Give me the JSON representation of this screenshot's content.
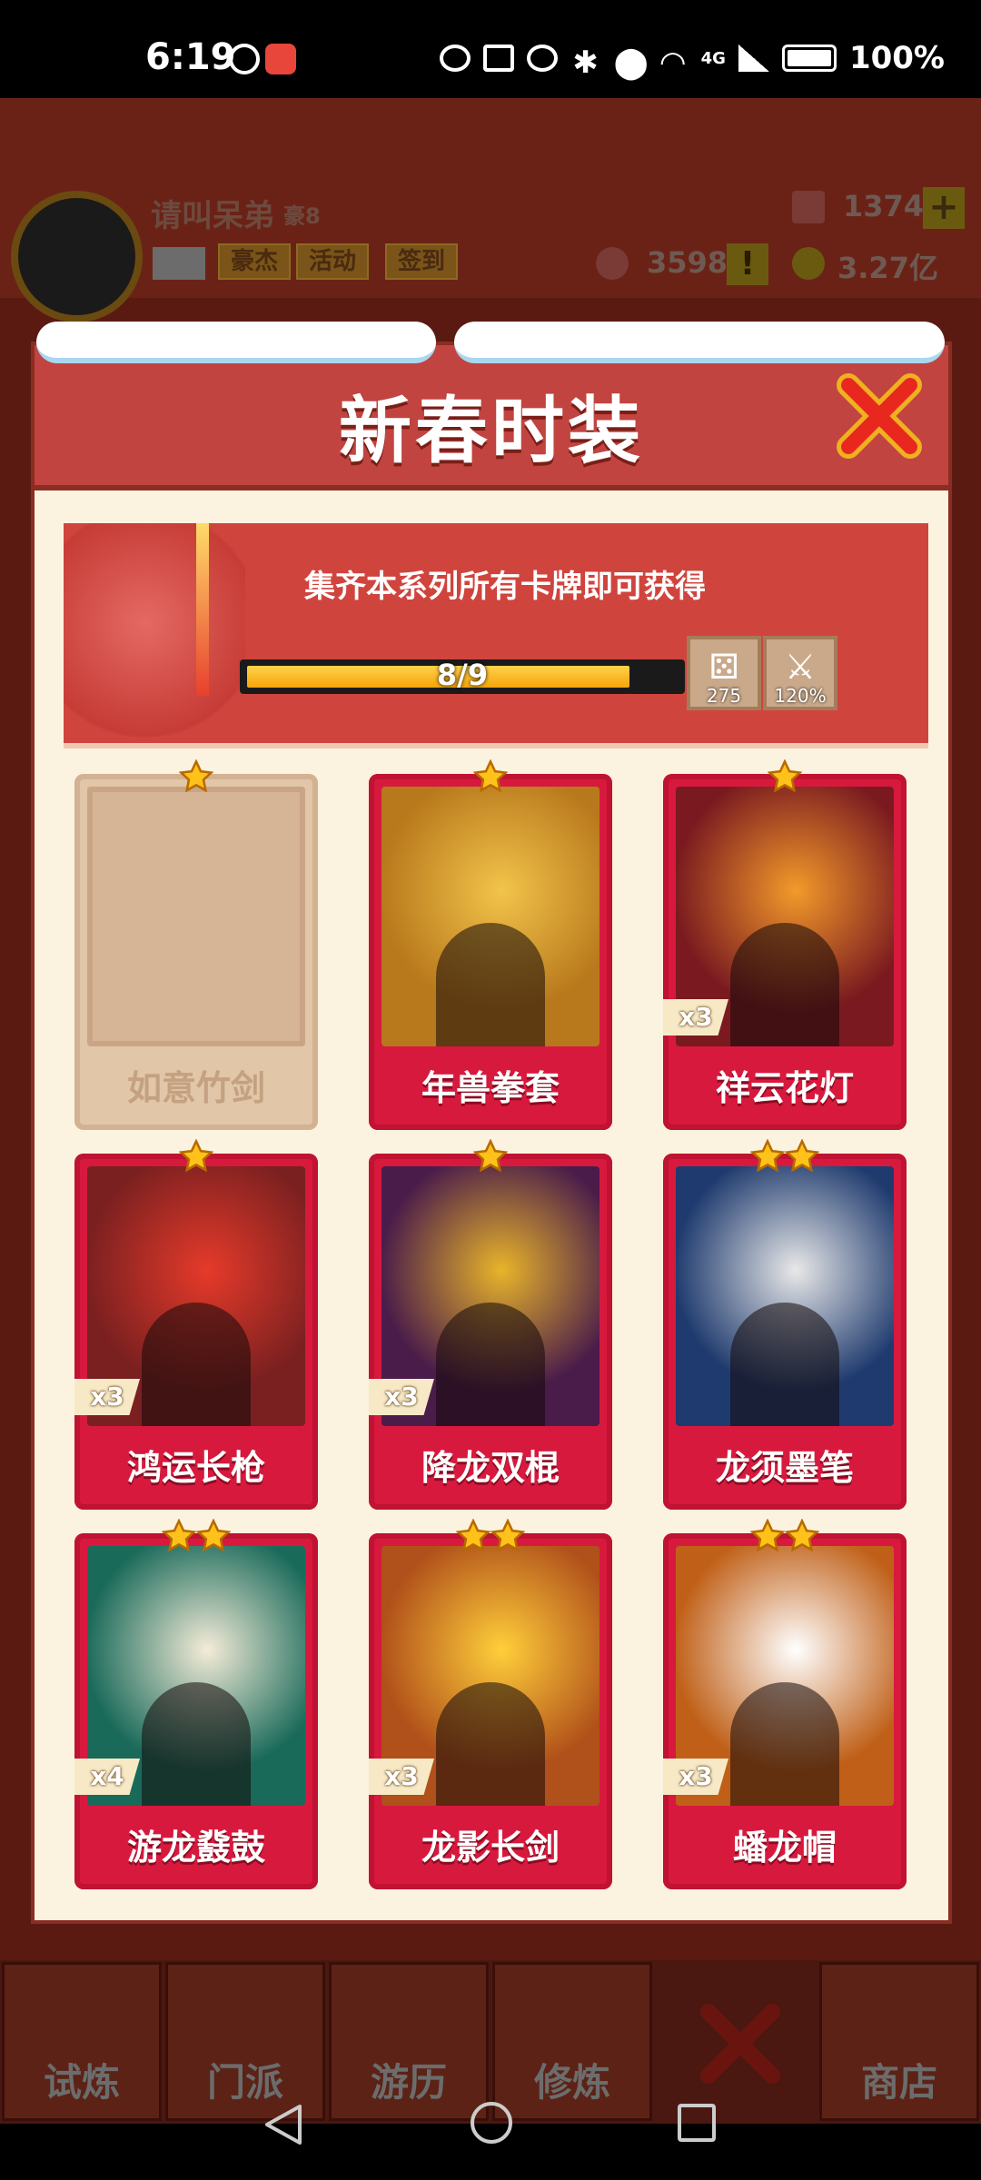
{
  "status_bar": {
    "time": "6:19",
    "battery": "100%",
    "network": "4G"
  },
  "player": {
    "name": "请叫呆弟",
    "rank": "豪8",
    "buttons": [
      "豪杰",
      "活动",
      "签到"
    ],
    "gems": "1374",
    "token": "3598",
    "gold": "3.27亿"
  },
  "modal": {
    "title": "新春时装",
    "banner_text": "集齐本系列所有卡牌即可获得",
    "progress": {
      "label": "8/9",
      "fraction": 0.889
    },
    "rewards": [
      {
        "icon": "dice-icon",
        "value": "275"
      },
      {
        "icon": "blade-icon",
        "value": "120%"
      }
    ]
  },
  "cards": [
    {
      "name": "如意竹剑",
      "stars": 1,
      "count": "",
      "locked": true,
      "art": "#d6b596",
      "accent": "#c9a586"
    },
    {
      "name": "年兽拳套",
      "stars": 1,
      "count": "",
      "locked": false,
      "art": "#b8781c",
      "accent": "#f2c44a"
    },
    {
      "name": "祥云花灯",
      "stars": 1,
      "count": "x3",
      "locked": false,
      "art": "#7a1a20",
      "accent": "#f29a2a"
    },
    {
      "name": "鸿运长枪",
      "stars": 1,
      "count": "x3",
      "locked": false,
      "art": "#7a2020",
      "accent": "#e63a2a"
    },
    {
      "name": "降龙双棍",
      "stars": 1,
      "count": "x3",
      "locked": false,
      "art": "#4a1c4a",
      "accent": "#e8b42a"
    },
    {
      "name": "龙须墨笔",
      "stars": 2,
      "count": "",
      "locked": false,
      "art": "#1e3a6e",
      "accent": "#e8e8e8"
    },
    {
      "name": "游龙鼗鼓",
      "stars": 2,
      "count": "x4",
      "locked": false,
      "art": "#1a6a5a",
      "accent": "#f4ecd8"
    },
    {
      "name": "龙影长剑",
      "stars": 2,
      "count": "x3",
      "locked": false,
      "art": "#b0501a",
      "accent": "#ffcf3a"
    },
    {
      "name": "蟠龙帽",
      "stars": 2,
      "count": "x3",
      "locked": false,
      "art": "#c06018",
      "accent": "#ffffff"
    }
  ],
  "tabs": [
    "试炼",
    "门派",
    "游历",
    "修炼",
    "",
    "商店"
  ],
  "colors": {
    "header": "#c14440",
    "card_red": "#d8193e",
    "panel": "#fbf3df",
    "progress": "#f4a40c",
    "star": "#ffc21a"
  }
}
